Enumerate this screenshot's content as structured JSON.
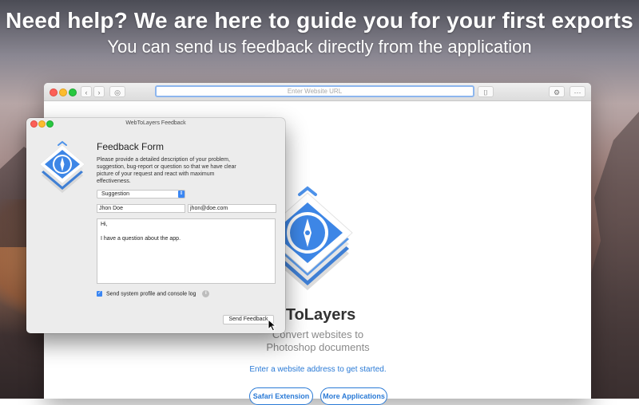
{
  "header": {
    "title": "Need help? We are here to guide you for your first exports",
    "subtitle": "You can send us feedback directly from the application"
  },
  "safari": {
    "url_placeholder": "Enter Website URL",
    "back_glyph": "‹",
    "forward_glyph": "›",
    "compass_glyph": "◎",
    "camera_glyph": "⌷",
    "settings_glyph": "⚙",
    "more_glyph": "⋯"
  },
  "app": {
    "title": "WebToLayers",
    "subtitle_line1": "Convert websites to",
    "subtitle_line2": "Photoshop documents",
    "cta": "Enter a website address to get started.",
    "button_safari": "Safari Extension",
    "button_more": "More Applications",
    "accent": "#2a7ad6"
  },
  "dialog": {
    "window_title": "WebToLayers Feedback",
    "form_title": "Feedback Form",
    "description": "Please provide a detailed description of your problem, suggestion, bug-report or question so that we have clear picture of your request and react with maximum effectiveness.",
    "category": "Suggestion",
    "name_value": "Jhon Doe",
    "email_value": "jhon@doe.com",
    "message_line1": "Hi,",
    "message_line2": "I have a question about the app.",
    "checkbox_label": "Send system profile and console log",
    "checkbox_checked": true,
    "send_label": "Send Feedback"
  }
}
